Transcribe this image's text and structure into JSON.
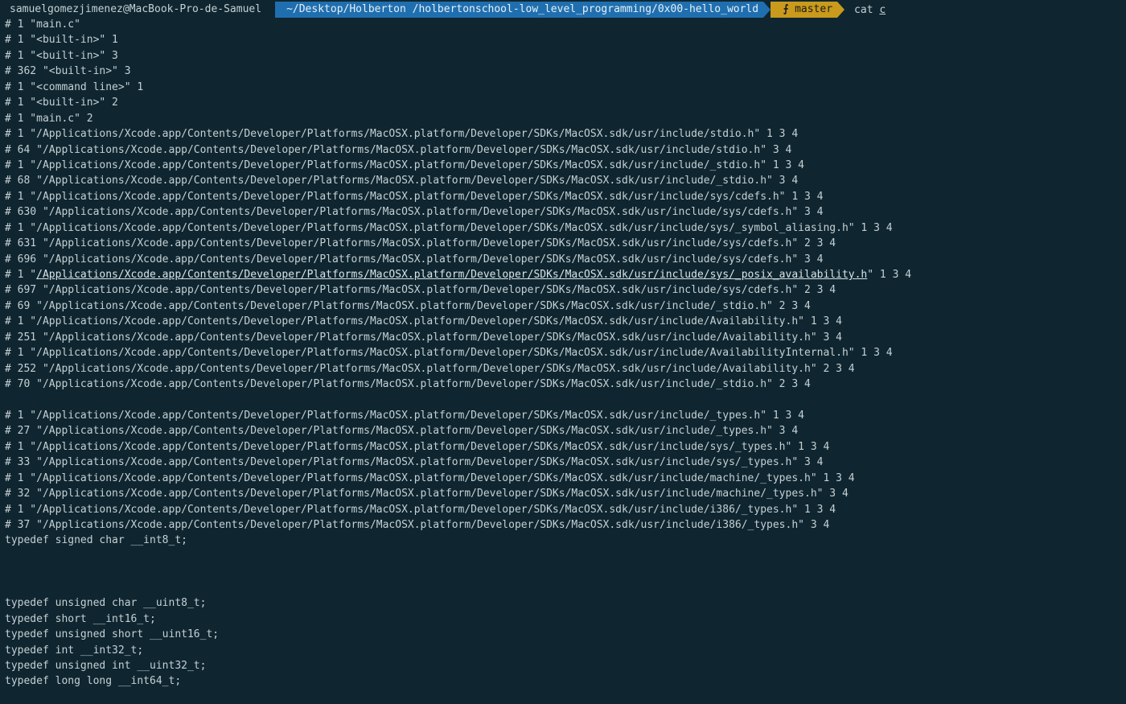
{
  "prompt": {
    "user_host": "samuelgomezjimenez@MacBook-Pro-de-Samuel",
    "path": "~/Desktop/Holberton /holbertonschool-low_level_programming/0x00-hello_world",
    "git_branch": "master",
    "branch_icon": "git-branch-icon",
    "command": "cat ",
    "command_cursor_char": "c"
  },
  "colors": {
    "background": "#0f2630",
    "text": "#c5d0d4",
    "path_segment": "#1f6fb0",
    "git_segment": "#c99a1b"
  },
  "output": {
    "lines": [
      "# 1 \"main.c\"",
      "# 1 \"<built-in>\" 1",
      "# 1 \"<built-in>\" 3",
      "# 362 \"<built-in>\" 3",
      "# 1 \"<command line>\" 1",
      "# 1 \"<built-in>\" 2",
      "# 1 \"main.c\" 2",
      "# 1 \"/Applications/Xcode.app/Contents/Developer/Platforms/MacOSX.platform/Developer/SDKs/MacOSX.sdk/usr/include/stdio.h\" 1 3 4",
      "# 64 \"/Applications/Xcode.app/Contents/Developer/Platforms/MacOSX.platform/Developer/SDKs/MacOSX.sdk/usr/include/stdio.h\" 3 4",
      "# 1 \"/Applications/Xcode.app/Contents/Developer/Platforms/MacOSX.platform/Developer/SDKs/MacOSX.sdk/usr/include/_stdio.h\" 1 3 4",
      "# 68 \"/Applications/Xcode.app/Contents/Developer/Platforms/MacOSX.platform/Developer/SDKs/MacOSX.sdk/usr/include/_stdio.h\" 3 4",
      "# 1 \"/Applications/Xcode.app/Contents/Developer/Platforms/MacOSX.platform/Developer/SDKs/MacOSX.sdk/usr/include/sys/cdefs.h\" 1 3 4",
      "# 630 \"/Applications/Xcode.app/Contents/Developer/Platforms/MacOSX.platform/Developer/SDKs/MacOSX.sdk/usr/include/sys/cdefs.h\" 3 4",
      "# 1 \"/Applications/Xcode.app/Contents/Developer/Platforms/MacOSX.platform/Developer/SDKs/MacOSX.sdk/usr/include/sys/_symbol_aliasing.h\" 1 3 4",
      "# 631 \"/Applications/Xcode.app/Contents/Developer/Platforms/MacOSX.platform/Developer/SDKs/MacOSX.sdk/usr/include/sys/cdefs.h\" 2 3 4",
      "# 696 \"/Applications/Xcode.app/Contents/Developer/Platforms/MacOSX.platform/Developer/SDKs/MacOSX.sdk/usr/include/sys/cdefs.h\" 3 4",
      "# 1 \"/Applications/Xcode.app/Contents/Developer/Platforms/MacOSX.platform/Developer/SDKs/MacOSX.sdk/usr/include/sys/_posix_availability.h\" 1 3 4",
      "# 697 \"/Applications/Xcode.app/Contents/Developer/Platforms/MacOSX.platform/Developer/SDKs/MacOSX.sdk/usr/include/sys/cdefs.h\" 2 3 4",
      "# 69 \"/Applications/Xcode.app/Contents/Developer/Platforms/MacOSX.platform/Developer/SDKs/MacOSX.sdk/usr/include/_stdio.h\" 2 3 4",
      "# 1 \"/Applications/Xcode.app/Contents/Developer/Platforms/MacOSX.platform/Developer/SDKs/MacOSX.sdk/usr/include/Availability.h\" 1 3 4",
      "# 251 \"/Applications/Xcode.app/Contents/Developer/Platforms/MacOSX.platform/Developer/SDKs/MacOSX.sdk/usr/include/Availability.h\" 3 4",
      "# 1 \"/Applications/Xcode.app/Contents/Developer/Platforms/MacOSX.platform/Developer/SDKs/MacOSX.sdk/usr/include/AvailabilityInternal.h\" 1 3 4",
      "# 252 \"/Applications/Xcode.app/Contents/Developer/Platforms/MacOSX.platform/Developer/SDKs/MacOSX.sdk/usr/include/Availability.h\" 2 3 4",
      "# 70 \"/Applications/Xcode.app/Contents/Developer/Platforms/MacOSX.platform/Developer/SDKs/MacOSX.sdk/usr/include/_stdio.h\" 2 3 4",
      "",
      "# 1 \"/Applications/Xcode.app/Contents/Developer/Platforms/MacOSX.platform/Developer/SDKs/MacOSX.sdk/usr/include/_types.h\" 1 3 4",
      "# 27 \"/Applications/Xcode.app/Contents/Developer/Platforms/MacOSX.platform/Developer/SDKs/MacOSX.sdk/usr/include/_types.h\" 3 4",
      "# 1 \"/Applications/Xcode.app/Contents/Developer/Platforms/MacOSX.platform/Developer/SDKs/MacOSX.sdk/usr/include/sys/_types.h\" 1 3 4",
      "# 33 \"/Applications/Xcode.app/Contents/Developer/Platforms/MacOSX.platform/Developer/SDKs/MacOSX.sdk/usr/include/sys/_types.h\" 3 4",
      "# 1 \"/Applications/Xcode.app/Contents/Developer/Platforms/MacOSX.platform/Developer/SDKs/MacOSX.sdk/usr/include/machine/_types.h\" 1 3 4",
      "# 32 \"/Applications/Xcode.app/Contents/Developer/Platforms/MacOSX.platform/Developer/SDKs/MacOSX.sdk/usr/include/machine/_types.h\" 3 4",
      "# 1 \"/Applications/Xcode.app/Contents/Developer/Platforms/MacOSX.platform/Developer/SDKs/MacOSX.sdk/usr/include/i386/_types.h\" 1 3 4",
      "# 37 \"/Applications/Xcode.app/Contents/Developer/Platforms/MacOSX.platform/Developer/SDKs/MacOSX.sdk/usr/include/i386/_types.h\" 3 4",
      "typedef signed char __int8_t;",
      "",
      "",
      "",
      "typedef unsigned char __uint8_t;",
      "typedef short __int16_t;",
      "typedef unsigned short __uint16_t;",
      "typedef int __int32_t;",
      "typedef unsigned int __uint32_t;",
      "typedef long long __int64_t;"
    ],
    "hovered_link": {
      "line_index": 16,
      "prefix": "# 1 \"",
      "link_text": "/Applications/Xcode.app/Contents/Developer/Platforms/MacOSX.platform/Developer/SDKs/MacOSX.sdk/usr/include/sys/_posix_availability.h",
      "suffix": "\" 1 3 4"
    }
  }
}
